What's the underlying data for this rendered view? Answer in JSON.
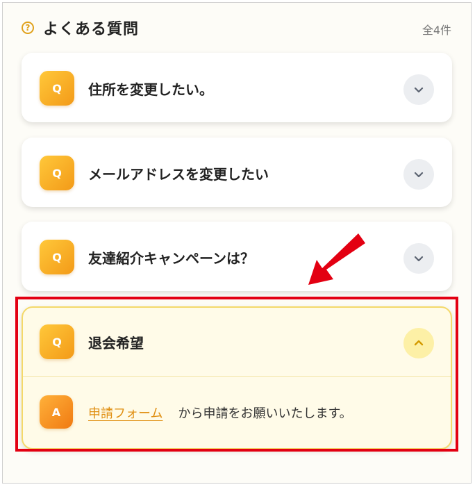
{
  "header": {
    "help_icon": "?",
    "title": "よくある質問",
    "count": "全4件"
  },
  "faq": [
    {
      "q_badge": "Q",
      "question": "住所を変更したい。",
      "expanded": false
    },
    {
      "q_badge": "Q",
      "question": "メールアドレスを変更したい",
      "expanded": false
    },
    {
      "q_badge": "Q",
      "question": "友達紹介キャンペーンは？",
      "expanded": false
    },
    {
      "q_badge": "Q",
      "question": "退会希望",
      "expanded": true,
      "a_badge": "A",
      "answer_link": "申請フォーム",
      "answer_text": "から申請をお願いいたします。"
    }
  ],
  "colors": {
    "accent": "#f39a18",
    "highlight": "#e30012",
    "link": "#e08f12"
  },
  "icons": {
    "help": "question-circle-icon",
    "collapsed": "chevron-down-icon",
    "expanded": "chevron-up-icon",
    "annotation": "red-arrow-icon"
  }
}
